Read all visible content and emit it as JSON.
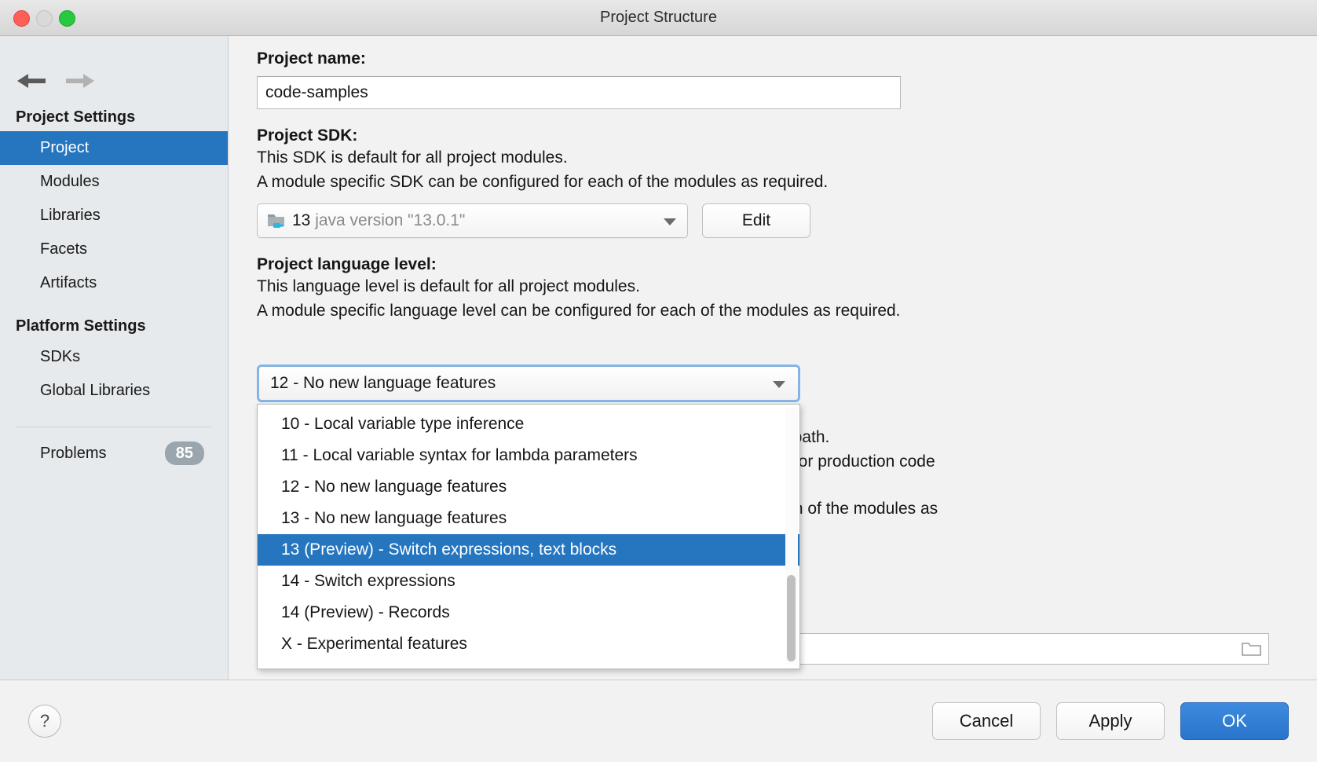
{
  "window": {
    "title": "Project Structure",
    "traffic_lights": [
      "close",
      "minimize",
      "maximize"
    ]
  },
  "sidebar": {
    "nav": {
      "back_icon": "arrow-left-icon",
      "forward_icon": "arrow-right-icon"
    },
    "groups": [
      {
        "header": "Project Settings",
        "items": [
          {
            "label": "Project",
            "selected": true
          },
          {
            "label": "Modules",
            "selected": false
          },
          {
            "label": "Libraries",
            "selected": false
          },
          {
            "label": "Facets",
            "selected": false
          },
          {
            "label": "Artifacts",
            "selected": false
          }
        ]
      },
      {
        "header": "Platform Settings",
        "items": [
          {
            "label": "SDKs",
            "selected": false
          },
          {
            "label": "Global Libraries",
            "selected": false
          }
        ]
      }
    ],
    "problems": {
      "label": "Problems",
      "count": "85"
    }
  },
  "main": {
    "project_name": {
      "label": "Project name:",
      "value": "code-samples",
      "placeholder": ""
    },
    "project_sdk": {
      "label": "Project SDK:",
      "description_line1": "This SDK is default for all project modules.",
      "description_line2": "A module specific SDK can be configured for each of the modules as required.",
      "selected_version": "13",
      "selected_detail": "java version \"13.0.1\"",
      "icon": "java-sdk-folder-icon",
      "edit_button": "Edit"
    },
    "project_language_level": {
      "label": "Project language level:",
      "description_line1": "This language level is default for all project modules.",
      "description_line2": "A module specific language level can be configured for each of the modules as required.",
      "selected": "12 - No new language features",
      "options": [
        "10 - Local variable type inference",
        "11 - Local variable syntax for lambda parameters",
        "12 - No new language features",
        "13 - No new language features",
        "13 (Preview) - Switch expressions, text blocks",
        "14 - Switch expressions",
        "14 (Preview) - Records",
        "X - Experimental features"
      ],
      "highlighted_option": "13 (Preview) - Switch expressions, text blocks"
    },
    "project_compiler_output": {
      "visible_fragment_1": "his path.",
      "visible_fragment_2": "est for production code",
      "visible_fragment_3": " each of the modules as",
      "path_value": "",
      "browse_icon": "folder-icon"
    }
  },
  "footer": {
    "help_label": "?",
    "cancel_label": "Cancel",
    "apply_label": "Apply",
    "ok_label": "OK"
  },
  "colors": {
    "accent_blue": "#2675bf",
    "selection_blue": "#2675bf",
    "primary_button": "#2a74cc",
    "sidebar_bg": "#e6eaed",
    "panel_bg": "#f2f2f2",
    "badge_gray": "#9aa5ad",
    "focus_ring": "#84b5e5"
  }
}
